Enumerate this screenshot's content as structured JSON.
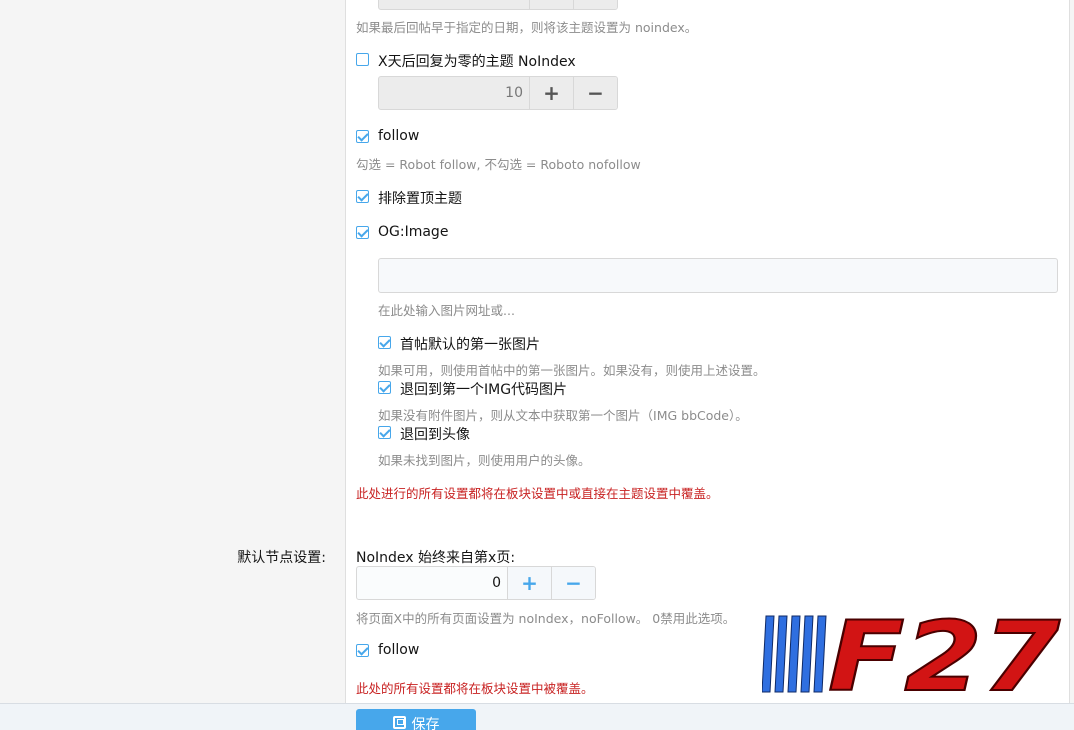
{
  "top_section": {
    "date_hint": "如果最后回帖早于指定的日期，则将该主题设置为 noindex。",
    "zero_reply_label": "X天后回复为零的主题 NoIndex",
    "zero_reply_checked": false,
    "zero_reply_days": "10",
    "plus_symbol": "+",
    "minus_symbol": "−",
    "follow_label": "follow",
    "follow_checked": true,
    "follow_hint": "勾选 = Robot follow, 不勾选 = Roboto nofollow",
    "exclude_sticky_label": "排除置顶主题",
    "exclude_sticky_checked": true,
    "og_image_label": "OG:Image",
    "og_image_checked": true,
    "og_image_value": "",
    "og_image_hint": "在此处输入图片网址或...",
    "first_image_label": "首帖默认的第一张图片",
    "first_image_checked": true,
    "first_image_hint": "如果可用，则使用首帖中的第一张图片。如果没有，则使用上述设置。",
    "fallback_img_label": "退回到第一个IMG代码图片",
    "fallback_img_checked": true,
    "fallback_img_hint": "如果没有附件图片，则从文本中获取第一个图片（IMG bbCode）。",
    "fallback_avatar_label": "退回到头像",
    "fallback_avatar_checked": true,
    "fallback_avatar_hint": "如果未找到图片，则使用用户的头像。",
    "override_warning": "此处进行的所有设置都将在板块设置中或直接在主题设置中覆盖。"
  },
  "node_section": {
    "row_label": "默认节点设置:",
    "noindex_label": "NoIndex 始终来自第x页:",
    "noindex_page": "0",
    "noindex_hint": "将页面X中的所有页面设置为 noIndex，noFollow。 0禁用此选项。",
    "follow_label": "follow",
    "follow_checked": true,
    "override_warning": "此处的所有设置都将在板块设置中被覆盖。"
  },
  "footer": {
    "save_label": "保存"
  },
  "logo_text": "F27",
  "colors": {
    "accent": "#47a7eb",
    "warning": "#c82222",
    "logo_blue": "#2f6fe0",
    "logo_red": "#d21414"
  }
}
